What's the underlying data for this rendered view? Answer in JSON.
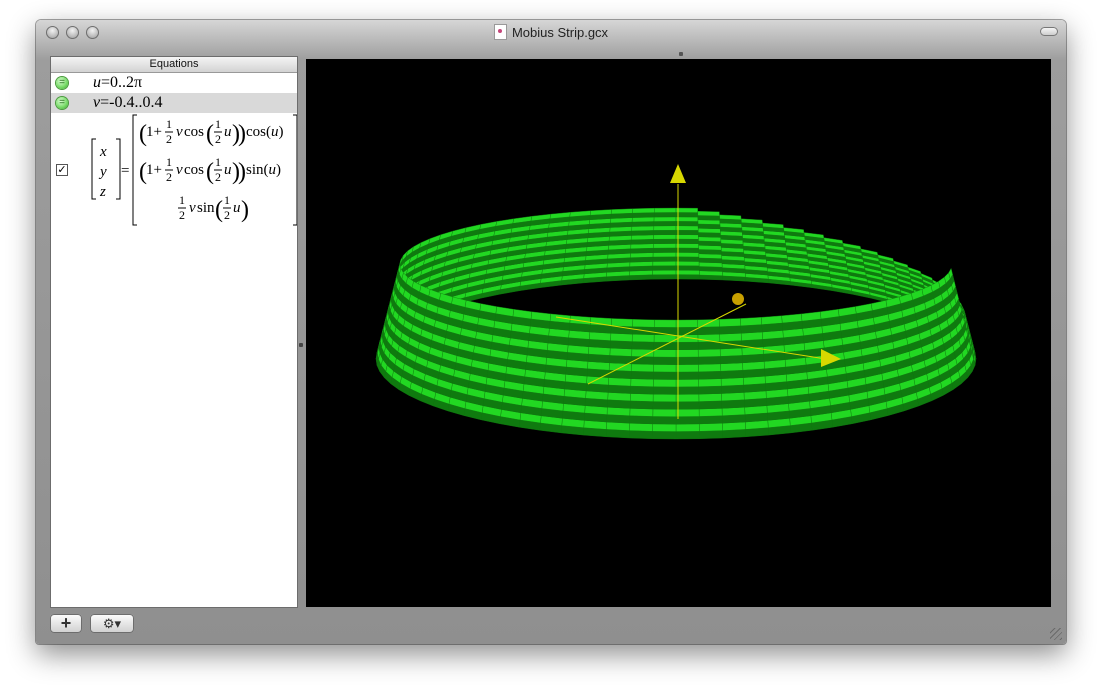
{
  "window": {
    "title": "Mobius Strip.gcx"
  },
  "equations_panel": {
    "header": "Equations",
    "rows": [
      {
        "var": "u",
        "text": "=0..2π",
        "status_icon": "equals-icon"
      },
      {
        "var": "v",
        "text": "=-0.4..0.4",
        "status_icon": "equals-icon",
        "selected": true
      }
    ],
    "matrix": {
      "checked": true,
      "lhs": [
        "x",
        "y",
        "z"
      ],
      "rhs_rows": [
        "(1+½v cos(½u)) cos(u)",
        "(1+½v cos(½u)) sin(u)",
        "½v sin(½u)"
      ]
    }
  },
  "bottom_buttons": {
    "add_label": "+",
    "gear_label": "⚙▾"
  },
  "plot": {
    "surface_color": "#22d822",
    "surface_dark": "#0f7a0f",
    "axis_color": "#d8d800",
    "background": "#000000"
  }
}
